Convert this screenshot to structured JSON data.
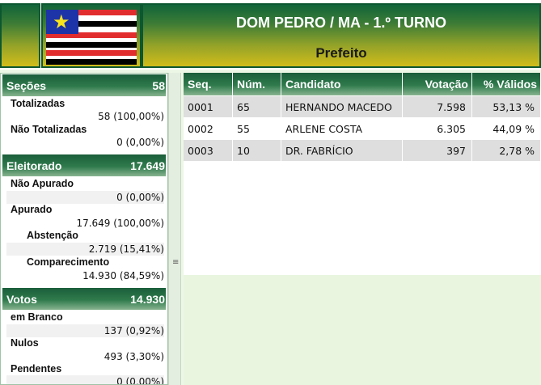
{
  "header": {
    "title": "DOM PEDRO / MA - 1.º TURNO",
    "subtitle": "Prefeito",
    "flag_icon": "maranhao-flag-icon",
    "colors": {
      "green": "#11643a",
      "gold": "#d2bc1b"
    }
  },
  "left": {
    "secoes": {
      "label": "Seções",
      "value": "58",
      "totalizadas_label": "Totalizadas",
      "totalizadas_value": "58 (100,00%)",
      "nao_totalizadas_label": "Não Totalizadas",
      "nao_totalizadas_value": "0 (0,00%)"
    },
    "eleitorado": {
      "label": "Eleitorado",
      "value": "17.649",
      "nao_apurado_label": "Não Apurado",
      "nao_apurado_value": "0 (0,00%)",
      "apurado_label": "Apurado",
      "apurado_value": "17.649 (100,00%)",
      "abstencao_label": "Abstenção",
      "abstencao_value": "2.719 (15,41%)",
      "comparecimento_label": "Comparecimento",
      "comparecimento_value": "14.930 (84,59%)"
    },
    "votos": {
      "label": "Votos",
      "value": "14.930",
      "branco_label": "em Branco",
      "branco_value": "137 (0,92%)",
      "nulos_label": "Nulos",
      "nulos_value": "493 (3,30%)",
      "pendentes_label": "Pendentes",
      "pendentes_value": "0 (0,00%)"
    }
  },
  "table": {
    "headers": {
      "seq": "Seq.",
      "num": "Núm.",
      "candidato": "Candidato",
      "votacao": "Votação",
      "validos": "% Válidos"
    },
    "rows": [
      {
        "seq": "0001",
        "num": "65",
        "candidato": "HERNANDO MACEDO",
        "votacao": "7.598",
        "validos": "53,13 %"
      },
      {
        "seq": "0002",
        "num": "55",
        "candidato": "ARLENE COSTA",
        "votacao": "6.305",
        "validos": "44,09 %"
      },
      {
        "seq": "0003",
        "num": "10",
        "candidato": "DR. FABRÍCIO",
        "votacao": "397",
        "validos": "2,78 %"
      }
    ]
  }
}
